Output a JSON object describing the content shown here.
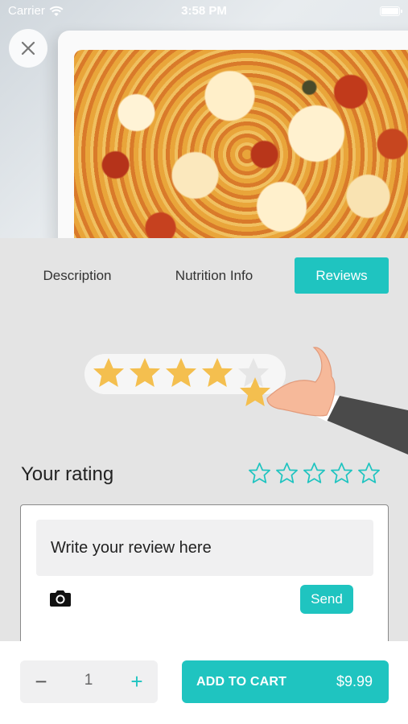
{
  "status_bar": {
    "carrier": "Carrier",
    "time": "3:58 PM"
  },
  "hero": {
    "image": "lasagna-dish",
    "close_icon": "close-icon"
  },
  "tabs": [
    {
      "label": "Description",
      "active": false
    },
    {
      "label": "Nutrition Info",
      "active": false
    },
    {
      "label": "Reviews",
      "active": true
    }
  ],
  "illustration": {
    "stars_filled": 4,
    "stars_total": 5
  },
  "rating": {
    "label": "Your rating",
    "value": 0,
    "max": 5
  },
  "review": {
    "placeholder": "Write your review here",
    "send_label": "Send",
    "camera_icon": "camera-icon"
  },
  "cart": {
    "quantity": "1",
    "minus": "−",
    "plus": "+",
    "add_label": "ADD TO CART",
    "price": "$9.99"
  },
  "colors": {
    "accent": "#1fc4c0",
    "star": "#f4bf4f",
    "background": "#e4e4e4"
  }
}
